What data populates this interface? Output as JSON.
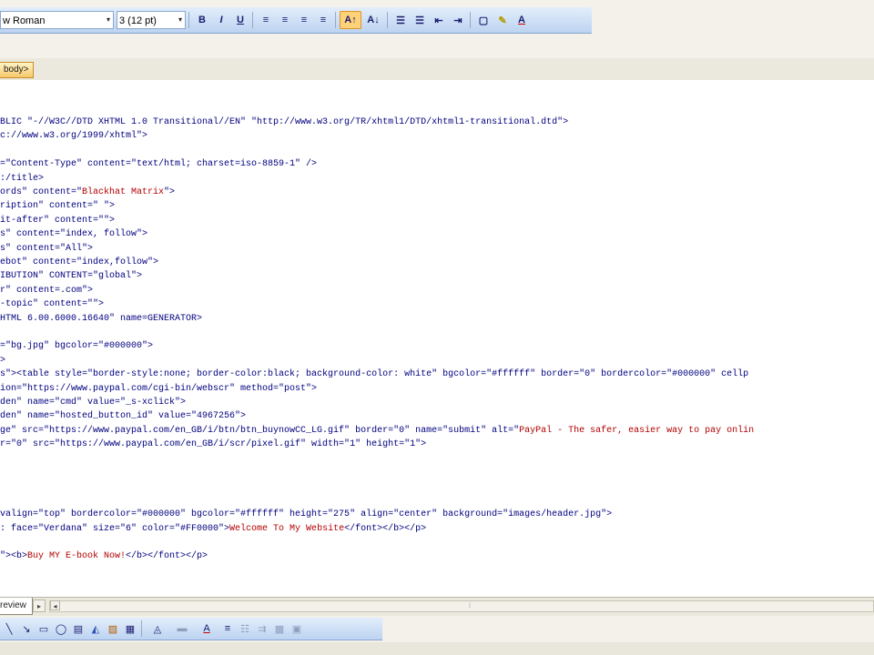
{
  "toolbar": {
    "font_name": "w Roman",
    "font_size": "3 (12 pt)",
    "dropdown_glyph": "▾",
    "buttons": {
      "bold": "B",
      "italic": "I",
      "underline": "U",
      "align_left": "≡",
      "align_center": "≡",
      "align_right": "≡",
      "justify": "≡",
      "increase_font": "A↑",
      "decrease_font": "A↓",
      "numbered_list": "☰",
      "bullet_list": "☰",
      "decrease_indent": "⇤",
      "increase_indent": "⇥",
      "borders": "▢",
      "highlight": "✎",
      "font_color": "A"
    }
  },
  "quick_tag": "body>",
  "code_lines": [
    {
      "parts": [
        {
          "t": "BLIC \"-//W3C//DTD XHTML 1.0 Transitional//EN\" \"http://www.w3.org/TR/xhtml1/DTD/xhtml1-transitional.dtd\">",
          "v": false
        }
      ]
    },
    {
      "parts": [
        {
          "t": "c://www.w3.org/1999/xhtml\">",
          "v": false
        }
      ]
    },
    {
      "parts": []
    },
    {
      "parts": [
        {
          "t": "=\"Content-Type\" content=\"text/html; charset=iso-8859-1\" />",
          "v": false
        }
      ]
    },
    {
      "parts": [
        {
          "t": ":/title>",
          "v": false
        }
      ]
    },
    {
      "parts": [
        {
          "t": "ords\" content=\"",
          "v": false
        },
        {
          "t": "Blackhat Matrix",
          "v": true
        },
        {
          "t": "\">",
          "v": false
        }
      ]
    },
    {
      "parts": [
        {
          "t": "ription\" content=\" \">",
          "v": false
        }
      ]
    },
    {
      "parts": [
        {
          "t": "it-after\" content=\"\">",
          "v": false
        }
      ]
    },
    {
      "parts": [
        {
          "t": "s\" content=\"index, follow\">",
          "v": false
        }
      ]
    },
    {
      "parts": [
        {
          "t": "s\" content=\"All\">",
          "v": false
        }
      ]
    },
    {
      "parts": [
        {
          "t": "ebot\" content=\"index,follow\">",
          "v": false
        }
      ]
    },
    {
      "parts": [
        {
          "t": "IBUTION\" CONTENT=\"global\">",
          "v": false
        }
      ]
    },
    {
      "parts": [
        {
          "t": "r\" content=.com\">",
          "v": false
        }
      ]
    },
    {
      "parts": [
        {
          "t": "-topic\" content=\"\">",
          "v": false
        }
      ]
    },
    {
      "parts": [
        {
          "t": "HTML 6.00.6000.16640\" name=GENERATOR>",
          "v": false
        }
      ]
    },
    {
      "parts": []
    },
    {
      "parts": [
        {
          "t": "=\"bg.jpg\" bgcolor=\"#000000\">",
          "v": false
        }
      ]
    },
    {
      "parts": [
        {
          "t": ">",
          "v": false
        }
      ]
    },
    {
      "parts": [
        {
          "t": "s\"><table style=\"border-style:none; border-color:black; background-color: white\" bgcolor=\"#ffffff\" border=\"0\" bordercolor=\"#000000\" cellp",
          "v": false
        }
      ]
    },
    {
      "parts": [
        {
          "t": "ion=\"https://www.paypal.com/cgi-bin/webscr\" method=\"post\">",
          "v": false
        }
      ]
    },
    {
      "parts": [
        {
          "t": "den\" name=\"cmd\" value=\"_s-xclick\">",
          "v": false
        }
      ]
    },
    {
      "parts": [
        {
          "t": "den\" name=\"hosted_button_id\" value=\"4967256\">",
          "v": false
        }
      ]
    },
    {
      "parts": [
        {
          "t": "ge\" src=\"https://www.paypal.com/en_GB/i/btn/btn_buynowCC_LG.gif\" border=\"0\" name=\"submit\" alt=\"",
          "v": false
        },
        {
          "t": "PayPal - The safer, easier way to pay onlin",
          "v": true
        }
      ]
    },
    {
      "parts": [
        {
          "t": "r=\"0\" src=\"https://www.paypal.com/en_GB/i/scr/pixel.gif\" width=\"1\" height=\"1\">",
          "v": false
        }
      ]
    },
    {
      "parts": []
    },
    {
      "parts": []
    },
    {
      "parts": []
    },
    {
      "parts": []
    },
    {
      "parts": [
        {
          "t": "valign=\"top\" bordercolor=\"#000000\" bgcolor=\"#ffffff\" height=\"275\" align=\"center\" background=\"images/header.jpg\">",
          "v": false
        }
      ]
    },
    {
      "parts": [
        {
          "t": ": face=\"Verdana\" size=\"6\" color=\"#FF0000\">",
          "v": false
        },
        {
          "t": "Welcome To My Website",
          "v": true
        },
        {
          "t": "</font></b></p>",
          "v": false
        }
      ]
    },
    {
      "parts": []
    },
    {
      "parts": [
        {
          "t": "\"><b>",
          "v": false
        },
        {
          "t": "Buy MY E-book Now!",
          "v": true
        },
        {
          "t": "</b></font></p>",
          "v": false
        }
      ]
    }
  ],
  "tabs": {
    "preview_label": "review",
    "nav_right": "▸",
    "nav_left": "◂",
    "scroll_grip": "⁞"
  },
  "drawing": {
    "line": "╲",
    "arrow": "↘",
    "rectangle": "▭",
    "oval": "◯",
    "textbox": "▤",
    "wordart": "◭",
    "clipart": "▨",
    "picture": "▦",
    "fill_color": "◬",
    "line_color": "▬",
    "font_color": "A",
    "line_style": "≡",
    "dash_style": "☷",
    "arrow_style": "⇉",
    "shadow": "▩",
    "three_d": "▣"
  },
  "colors": {
    "tag": "#00007f",
    "value": "#b30000",
    "toolbar_blue": "#bcd3f1"
  }
}
